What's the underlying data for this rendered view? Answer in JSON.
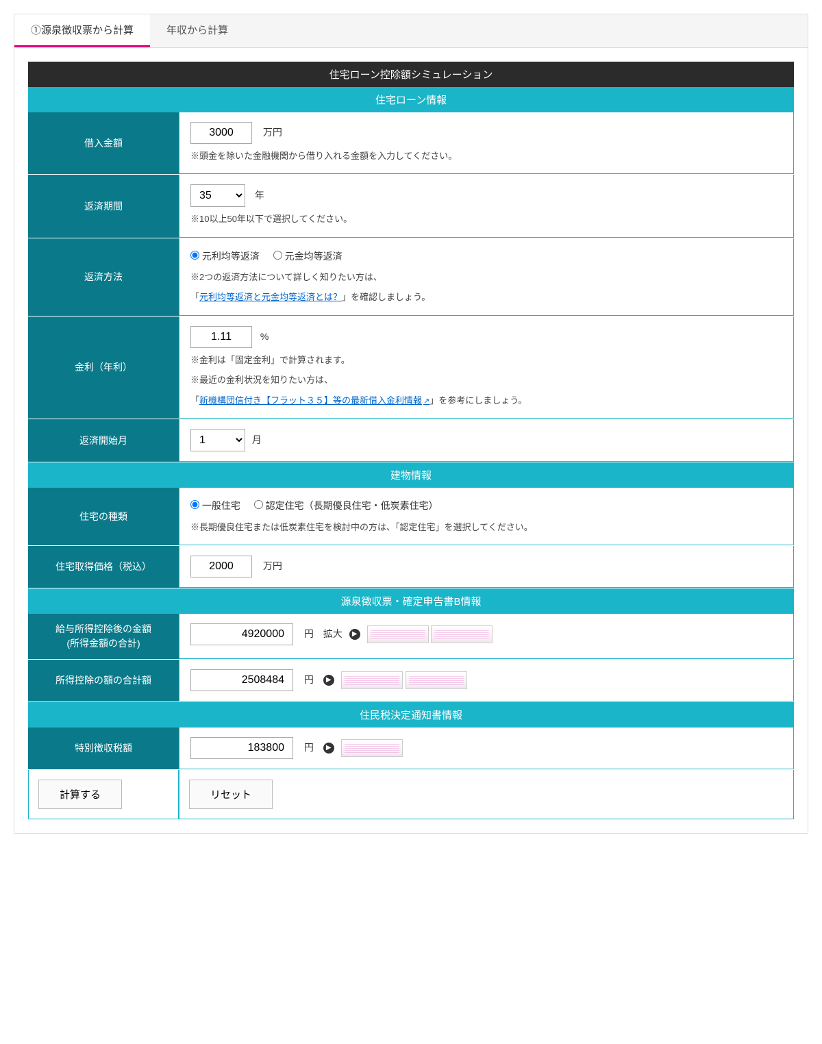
{
  "tabs": {
    "active": "①源泉徴収票から計算",
    "inactive": "年収から計算"
  },
  "title": "住宅ローン控除額シミュレーション",
  "sections": {
    "loan": "住宅ローン情報",
    "building": "建物情報",
    "gensen": "源泉徴収票・確定申告書B情報",
    "juminzei": "住民税決定通知書情報"
  },
  "loan": {
    "amount_label": "借入金額",
    "amount_value": "3000",
    "amount_unit": "万円",
    "amount_note": "※頭金を除いた金融機関から借り入れる金額を入力してください。",
    "period_label": "返済期間",
    "period_value": "35",
    "period_unit": "年",
    "period_note": "※10以上50年以下で選択してください。",
    "method_label": "返済方法",
    "method_opt1": "元利均等返済",
    "method_opt2": "元金均等返済",
    "method_note1": "※2つの返済方法について詳しく知りたい方は、",
    "method_link": "元利均等返済と元金均等返済とは？",
    "method_note2": "」を確認しましょう。",
    "rate_label": "金利（年利）",
    "rate_value": "1.11",
    "rate_unit": "%",
    "rate_note1": "※金利は「固定金利」で計算されます。",
    "rate_note2": "※最近の金利状況を知りたい方は、",
    "rate_link": "新機構団信付き【フラット３５】等の最新借入金利情報",
    "rate_note3": "」を参考にしましょう。",
    "start_label": "返済開始月",
    "start_value": "1",
    "start_unit": "月"
  },
  "building": {
    "type_label": "住宅の種類",
    "type_opt1": "一般住宅",
    "type_opt2": "認定住宅（長期優良住宅・低炭素住宅）",
    "type_note": "※長期優良住宅または低炭素住宅を検討中の方は、「認定住宅」を選択してください。",
    "price_label": "住宅取得価格（税込）",
    "price_value": "2000",
    "price_unit": "万円"
  },
  "gensen": {
    "income_label": "給与所得控除後の金額\n(所得金額の合計)",
    "income_value": "4920000",
    "income_unit": "円",
    "expand_label": "拡大",
    "deduction_label": "所得控除の額の合計額",
    "deduction_value": "2508484",
    "deduction_unit": "円"
  },
  "juminzei": {
    "tax_label": "特別徴収税額",
    "tax_value": "183800",
    "tax_unit": "円"
  },
  "buttons": {
    "calc": "計算する",
    "reset": "リセット"
  },
  "bracket_open": "「"
}
